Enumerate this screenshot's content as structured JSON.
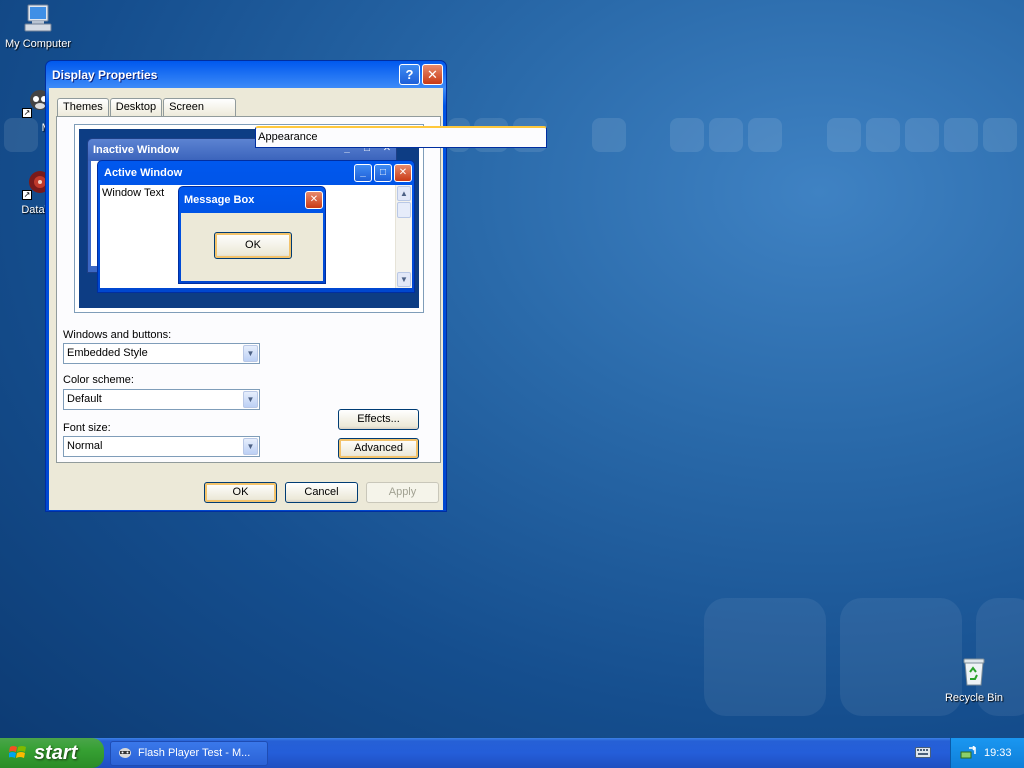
{
  "desktop": {
    "icons": [
      {
        "label": "My Computer",
        "icon": "computer-icon"
      },
      {
        "label": "Myp",
        "icon": "myp-app-icon"
      },
      {
        "label": "DataWa",
        "icon": "datawa-app-icon"
      },
      {
        "label": "Recycle Bin",
        "icon": "recycle-bin-icon"
      }
    ]
  },
  "window": {
    "title": "Display Properties",
    "help_glyph": "?",
    "close_glyph": "✕",
    "tabs": [
      "Themes",
      "Desktop",
      "Screen Saver",
      "Appearance"
    ],
    "active_tab": "Appearance",
    "preview": {
      "inactive_title": "Inactive Window",
      "active_title": "Active Window",
      "window_text": "Window Text",
      "message_title": "Message Box",
      "ok_label": "OK"
    },
    "fields": {
      "windows_buttons_label": "Windows and buttons:",
      "windows_buttons_value": "Embedded Style",
      "color_scheme_label": "Color scheme:",
      "color_scheme_value": "Default",
      "font_size_label": "Font size:",
      "font_size_value": "Normal"
    },
    "effects_label": "Effects...",
    "advanced_label": "Advanced",
    "ok_label": "OK",
    "cancel_label": "Cancel",
    "apply_label": "Apply"
  },
  "taskbar": {
    "start_label": "start",
    "task_label": "Flash Player Test - M...",
    "clock": "19:33"
  },
  "colors": {
    "accent": "#0054e3",
    "start_green": "#36a033",
    "default_button_ring": "#f3c36b"
  }
}
